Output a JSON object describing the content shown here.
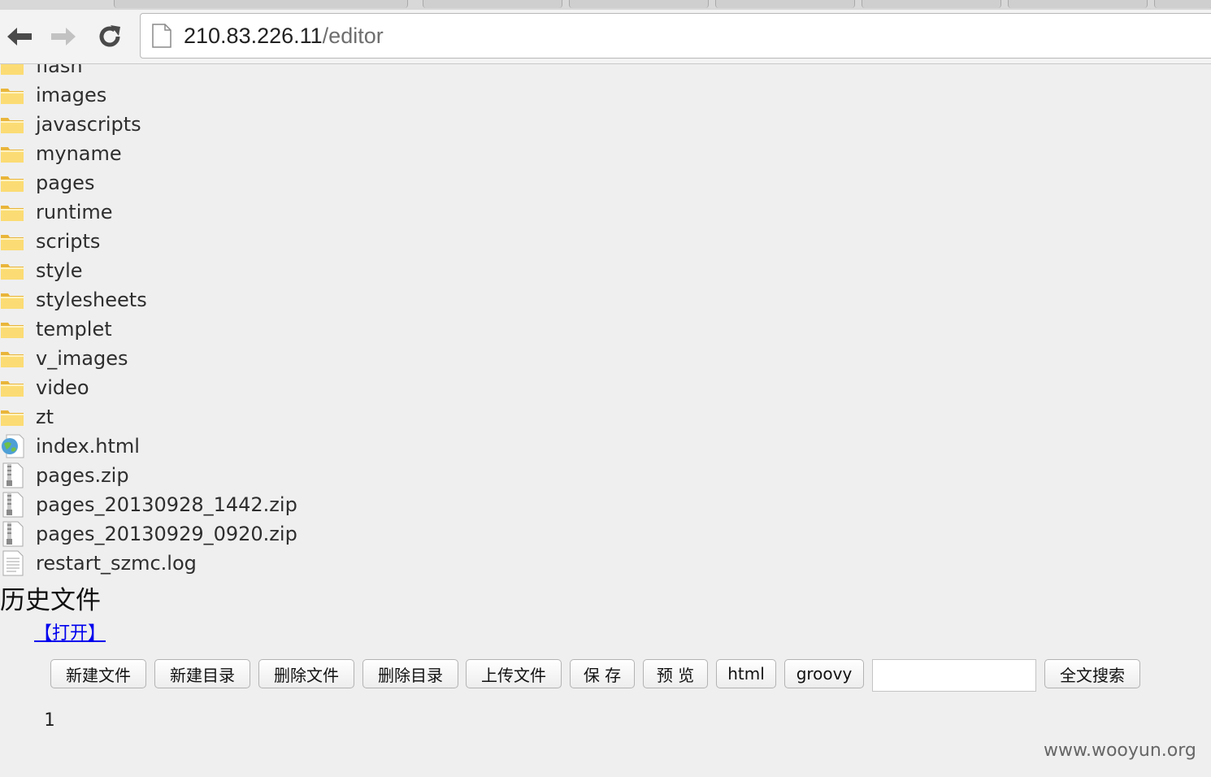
{
  "browser": {
    "url_host": "210.83.226.11",
    "url_path": "/editor",
    "back_icon": "arrow-left-icon",
    "forward_icon": "arrow-right-icon",
    "reload_icon": "reload-icon",
    "page_icon": "page-icon"
  },
  "files": [
    {
      "name": "flash",
      "icon": "folder-icon"
    },
    {
      "name": "images",
      "icon": "folder-icon"
    },
    {
      "name": "javascripts",
      "icon": "folder-icon"
    },
    {
      "name": "myname",
      "icon": "folder-icon"
    },
    {
      "name": "pages",
      "icon": "folder-icon"
    },
    {
      "name": "runtime",
      "icon": "folder-icon"
    },
    {
      "name": "scripts",
      "icon": "folder-icon"
    },
    {
      "name": "style",
      "icon": "folder-icon"
    },
    {
      "name": "stylesheets",
      "icon": "folder-icon"
    },
    {
      "name": "templet",
      "icon": "folder-icon"
    },
    {
      "name": "v_images",
      "icon": "folder-icon"
    },
    {
      "name": "video",
      "icon": "folder-icon"
    },
    {
      "name": "zt",
      "icon": "folder-icon"
    },
    {
      "name": "index.html",
      "icon": "html-file-icon"
    },
    {
      "name": "pages.zip",
      "icon": "zip-file-icon"
    },
    {
      "name": "pages_20130928_1442.zip",
      "icon": "zip-file-icon"
    },
    {
      "name": "pages_20130929_0920.zip",
      "icon": "zip-file-icon"
    },
    {
      "name": "restart_szmc.log",
      "icon": "text-file-icon"
    }
  ],
  "history": {
    "title": "历史文件",
    "open_link": "【打开】"
  },
  "toolbar": {
    "buttons": [
      "新建文件",
      "新建目录",
      "删除文件",
      "删除目录",
      "上传文件",
      "保 存",
      "预 览",
      "html",
      "groovy"
    ],
    "search_value": "",
    "search_button": "全文搜索"
  },
  "editor": {
    "line_number": "1"
  },
  "watermark": "www.wooyun.org",
  "colors": {
    "folder": "#f7cf5a",
    "link": "#0000ee",
    "page_background": "#efefef"
  }
}
